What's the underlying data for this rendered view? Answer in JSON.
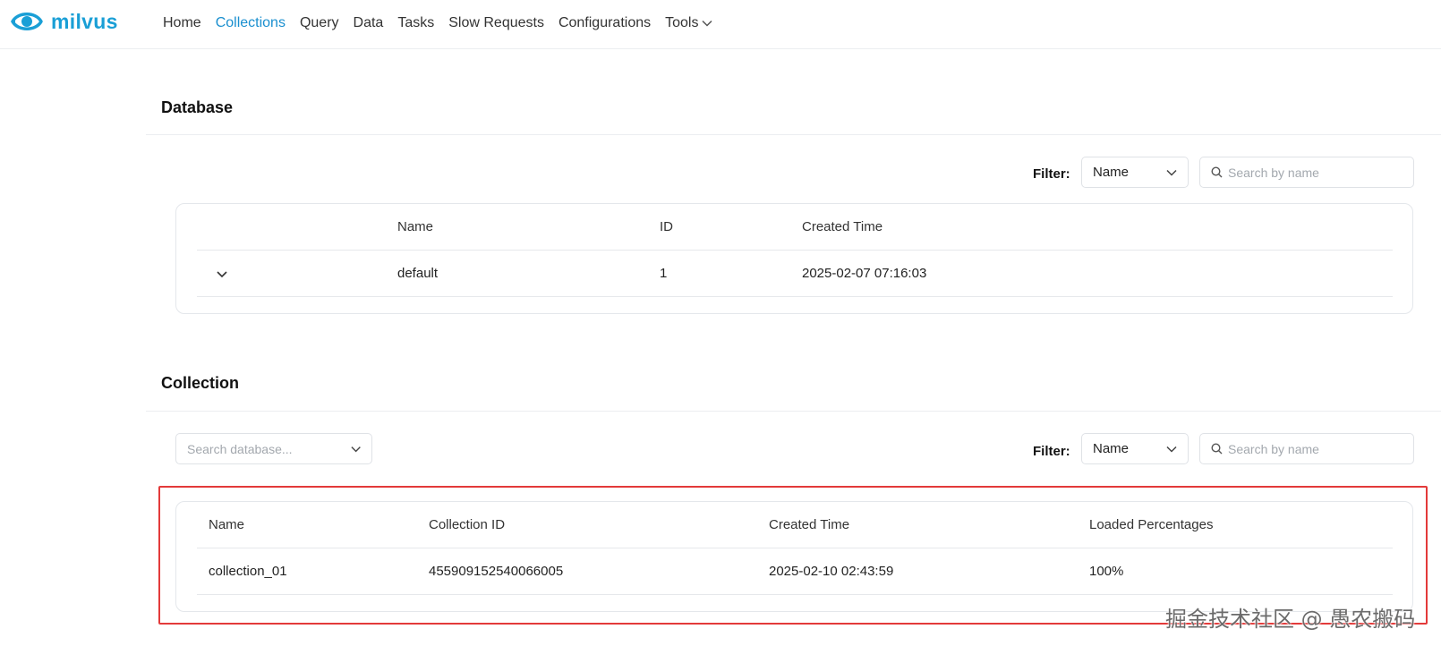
{
  "brand": {
    "name": "milvus",
    "color": "#1a9fd6"
  },
  "nav": {
    "items": [
      {
        "label": "Home",
        "active": false
      },
      {
        "label": "Collections",
        "active": true
      },
      {
        "label": "Query",
        "active": false
      },
      {
        "label": "Data",
        "active": false
      },
      {
        "label": "Tasks",
        "active": false
      },
      {
        "label": "Slow Requests",
        "active": false
      },
      {
        "label": "Configurations",
        "active": false
      }
    ],
    "tools_label": "Tools"
  },
  "database": {
    "title": "Database",
    "filter_label": "Filter:",
    "filter_value": "Name",
    "search_placeholder": "Search by name",
    "columns": [
      "Name",
      "ID",
      "Created Time"
    ],
    "rows": [
      {
        "name": "default",
        "id": "1",
        "created": "2025-02-07 07:16:03"
      }
    ]
  },
  "collection": {
    "title": "Collection",
    "db_placeholder": "Search database...",
    "filter_label": "Filter:",
    "filter_value": "Name",
    "search_placeholder": "Search by name",
    "columns": [
      "Name",
      "Collection ID",
      "Created Time",
      "Loaded Percentages"
    ],
    "rows": [
      {
        "name": "collection_01",
        "id": "455909152540066005",
        "created": "2025-02-10 02:43:59",
        "loaded": "100%"
      }
    ]
  },
  "highlight_color": "#e33a3a",
  "watermark": "掘金技术社区 @ 愚农搬码"
}
